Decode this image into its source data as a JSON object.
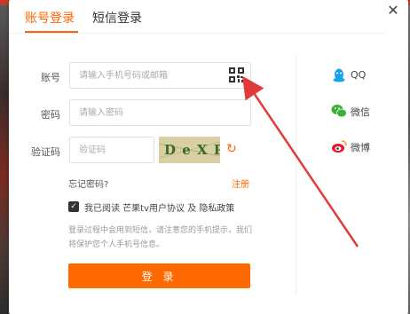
{
  "tabs": [
    {
      "label": "账号登录",
      "active": true
    },
    {
      "label": "短信登录",
      "active": false
    }
  ],
  "close_glyph": "✕",
  "form": {
    "account_label": "账号",
    "account_placeholder": "请输入手机号码或邮箱",
    "password_label": "密码",
    "password_placeholder": "请输入密码",
    "captcha_label": "验证码",
    "captcha_placeholder": "验证码",
    "captcha_text": "D e X P",
    "forgot": "忘记密码?",
    "register": "注册",
    "agree_prefix": "我已阅读 ",
    "agree_link1": "芒果tv用户协议",
    "agree_and": " 及 ",
    "agree_link2": "隐私政策",
    "agree_checked": true,
    "notice": "登录过程中会用到短信，请注意您的手机提示，我们将保护您个人手机号信息。",
    "login_button": "登 录"
  },
  "social": [
    {
      "name": "QQ",
      "icon": "qq-icon",
      "color": "#1aa3e8"
    },
    {
      "name": "微信",
      "icon": "wechat-icon",
      "color": "#3cb034"
    },
    {
      "name": "微博",
      "icon": "weibo-icon",
      "color": "#e6162d"
    }
  ],
  "colors": {
    "accent": "#ff6600",
    "annotation_arrow": "#e03a3a"
  }
}
